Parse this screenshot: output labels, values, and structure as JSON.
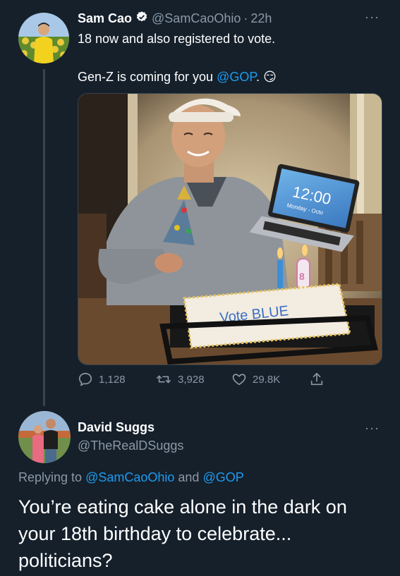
{
  "tweet": {
    "author_name": "Sam Cao",
    "author_handle": "@SamCaoOhio",
    "separator": "·",
    "time": "22h",
    "line1": "18 now and also registered to vote.",
    "line2_prefix": "Gen-Z is coming for you ",
    "line2_mention": "@GOP",
    "line2_suffix": ".",
    "emoji": "😏",
    "photo": {
      "laptop_time": "12:00",
      "laptop_date": "Monday - Octo",
      "cake_text": "Vote BLUE",
      "candle": "18"
    },
    "stats": {
      "replies": "1,128",
      "retweets": "3,928",
      "likes": "29.8K"
    }
  },
  "reply": {
    "author_name": "David Suggs",
    "author_handle": "@TheRealDSuggs",
    "replying_prefix": "Replying to ",
    "replying_mention1": "@SamCaoOhio",
    "replying_and": " and ",
    "replying_mention2": "@GOP",
    "text": "You’re eating cake alone in the dark on your 18th birthday to celebrate... politicians?"
  },
  "colors": {
    "background": "#15202b",
    "link": "#1d9bf0",
    "secondary_text": "#8b98a5",
    "verified": "#1d9bf0"
  }
}
